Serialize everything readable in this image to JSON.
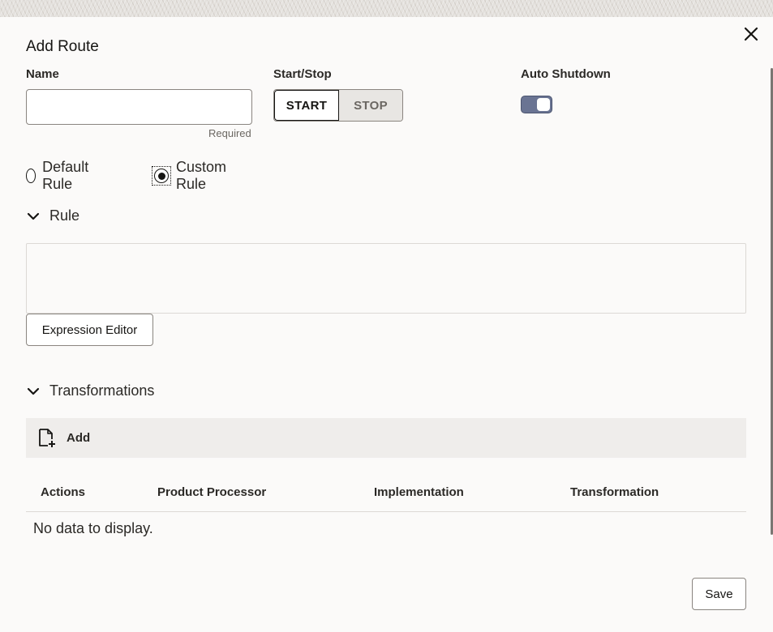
{
  "dialog": {
    "title": "Add Route"
  },
  "form": {
    "name": {
      "label": "Name",
      "value": "",
      "hint": "Required"
    },
    "start_stop": {
      "label": "Start/Stop",
      "options": [
        "START",
        "STOP"
      ],
      "selected": "START"
    },
    "auto_shutdown": {
      "label": "Auto Shutdown",
      "enabled": true
    },
    "rule_type": {
      "options": [
        "Default Rule",
        "Custom Rule"
      ],
      "selected": "Custom Rule"
    }
  },
  "rule_section": {
    "title": "Rule",
    "expression_editor_label": "Expression Editor"
  },
  "transformations_section": {
    "title": "Transformations",
    "add_label": "Add",
    "columns": [
      "Actions",
      "Product Processor",
      "Implementation",
      "Transformation"
    ],
    "rows": [],
    "empty_text": "No data to display."
  },
  "footer": {
    "save_label": "Save"
  },
  "icons": {
    "close": "close-icon",
    "chevron": "chevron-down-icon",
    "add": "add-document-icon"
  },
  "colors": {
    "toggle_on": "#6a7493",
    "toolbar_bg": "#efedeb",
    "page_bg": "#fbfaf9"
  }
}
